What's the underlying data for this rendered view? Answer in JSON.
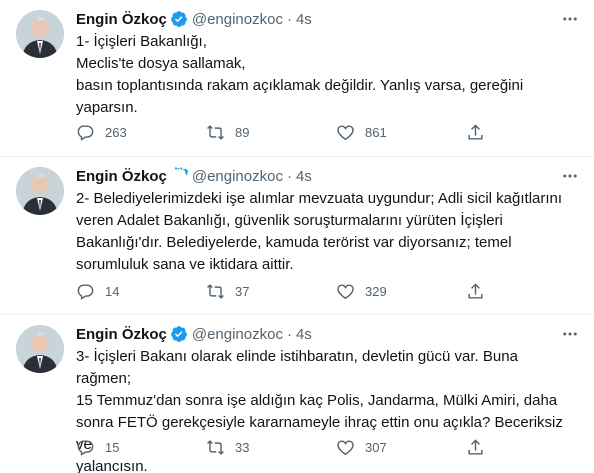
{
  "tweets": [
    {
      "name": "Engin Özkoç",
      "handle": "@enginozkoc",
      "separator": "·",
      "time": "4s",
      "lines": [
        "1- İçişleri Bakanlığı,",
        "Meclis'te dosya sallamak,",
        "basın toplantısında rakam açıklamak değildir. Yanlış varsa, gereğini",
        "yaparsın."
      ],
      "replies": "263",
      "retweets": "89",
      "likes": "861"
    },
    {
      "name": "Engin Özkoç",
      "handle": "@enginozkoc",
      "separator": "·",
      "time": "4s",
      "lines": [
        "2- Belediyelerimizdeki işe alımlar mevzuata uygundur; Adli sicil kağıtlarını",
        "veren Adalet Bakanlığı, güvenlik soruşturmalarını yürüten İçişleri",
        "Bakanlığı'dır. Belediyelerde, kamuda terörist var diyorsanız; temel",
        "sorumluluk sana ve iktidara aittir."
      ],
      "replies": "14",
      "retweets": "37",
      "likes": "329"
    },
    {
      "name": "Engin Özkoç",
      "handle": "@enginozkoc",
      "separator": "·",
      "time": "4s",
      "lines": [
        "3- İçişleri Bakanı olarak elinde istihbaratın, devletin gücü var. Buna rağmen;",
        "15 Temmuz'dan sonra işe aldığın kaç Polis, Jandarma, Mülki Amiri, daha",
        "sonra FETÖ gerekçesiyle kararnameyle ihraç ettin onu açıkla? Beceriksiz ve",
        "yalancısın."
      ],
      "replies": "15",
      "retweets": "33",
      "likes": "307"
    }
  ],
  "colors": {
    "text": "#0f1419",
    "secondary": "#536471",
    "verified": "#1d9bf0",
    "divider": "#eff3f4"
  },
  "icons": [
    "avatar",
    "verified-badge-icon",
    "more-icon",
    "reply-icon",
    "retweet-icon",
    "like-icon",
    "share-icon"
  ]
}
